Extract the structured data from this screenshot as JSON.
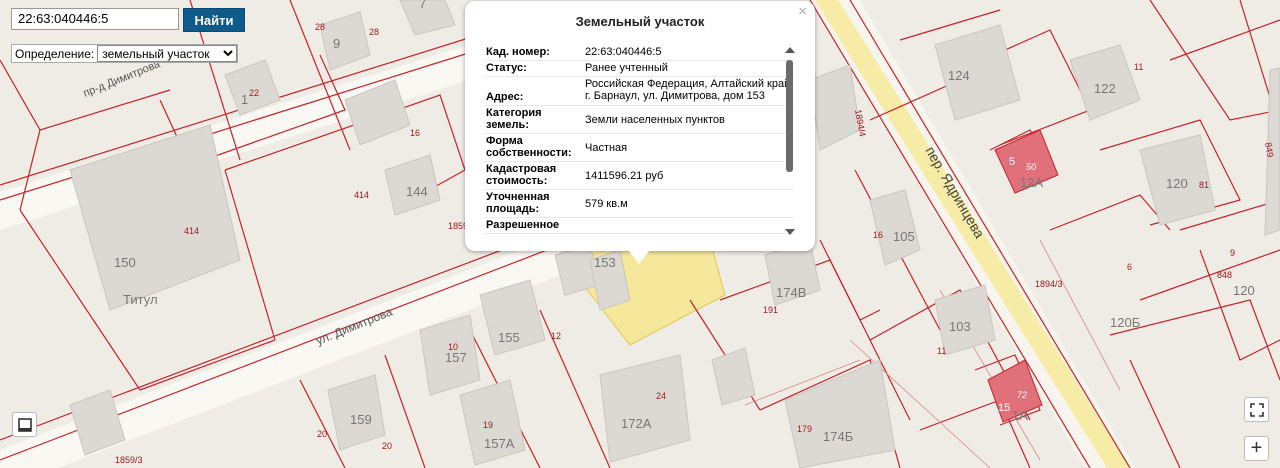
{
  "search": {
    "value": "22:63:040446:5",
    "button_label": "Найти"
  },
  "definition": {
    "label": "Определение:",
    "selected": "земельный участок"
  },
  "popup": {
    "title": "Земельный участок",
    "close_icon": "×",
    "rows": [
      {
        "key": "Кад. номер",
        "value": "22:63:040446:5"
      },
      {
        "key": "Статус",
        "value": "Ранее учтенный"
      },
      {
        "key": "Адрес",
        "value": "Российская Федерация, Алтайский край, г. Барнаул, ул. Димитрова, дом 153"
      },
      {
        "key": "Категория земель",
        "value": "Земли населенных пунктов"
      },
      {
        "key": "Форма собственности",
        "value": "Частная"
      },
      {
        "key": "Кадастровая стоимость",
        "value": "1411596.21 руб"
      },
      {
        "key": "Уточненная площадь",
        "value": "579 кв.м"
      },
      {
        "key": "Разрешенное",
        "value": ""
      }
    ]
  },
  "map": {
    "streets": {
      "dimitrova_upper": "пр-д Димитрова",
      "dimitrova_lower": "ул. Димитрова",
      "yadrintseva": "пер. Ядринцева"
    },
    "buildings": [
      "7",
      "9",
      "12",
      "124",
      "122",
      "144",
      "150",
      "Титул",
      "153",
      "155",
      "157",
      "157А",
      "159",
      "172А",
      "174Б",
      "174В",
      "105",
      "103",
      "120",
      "120Б",
      "12А",
      "1А",
      "5",
      "15",
      "50",
      "72"
    ],
    "parcels": [
      "28",
      "28",
      "16",
      "414",
      "414",
      "1859",
      "1859/3",
      "1894/4",
      "1894/3",
      "849",
      "848",
      "191",
      "179",
      "11",
      "81",
      "9",
      "6",
      "24",
      "19",
      "20",
      "20",
      "10",
      "16",
      "12",
      "11",
      "22"
    ]
  },
  "controls": {
    "layers_icon": "layers-icon",
    "fullscreen_icon": "fullscreen-icon",
    "zoom_in_icon": "zoom-in-icon",
    "zoom_in_label": "+"
  },
  "colors": {
    "parcel_line": "#c8222a",
    "selected_parcel": "#f6e89a",
    "road": "#fff6c8",
    "building": "#dcd9d4",
    "highlight_building": "#e0707a",
    "button": "#0e5a8a"
  }
}
